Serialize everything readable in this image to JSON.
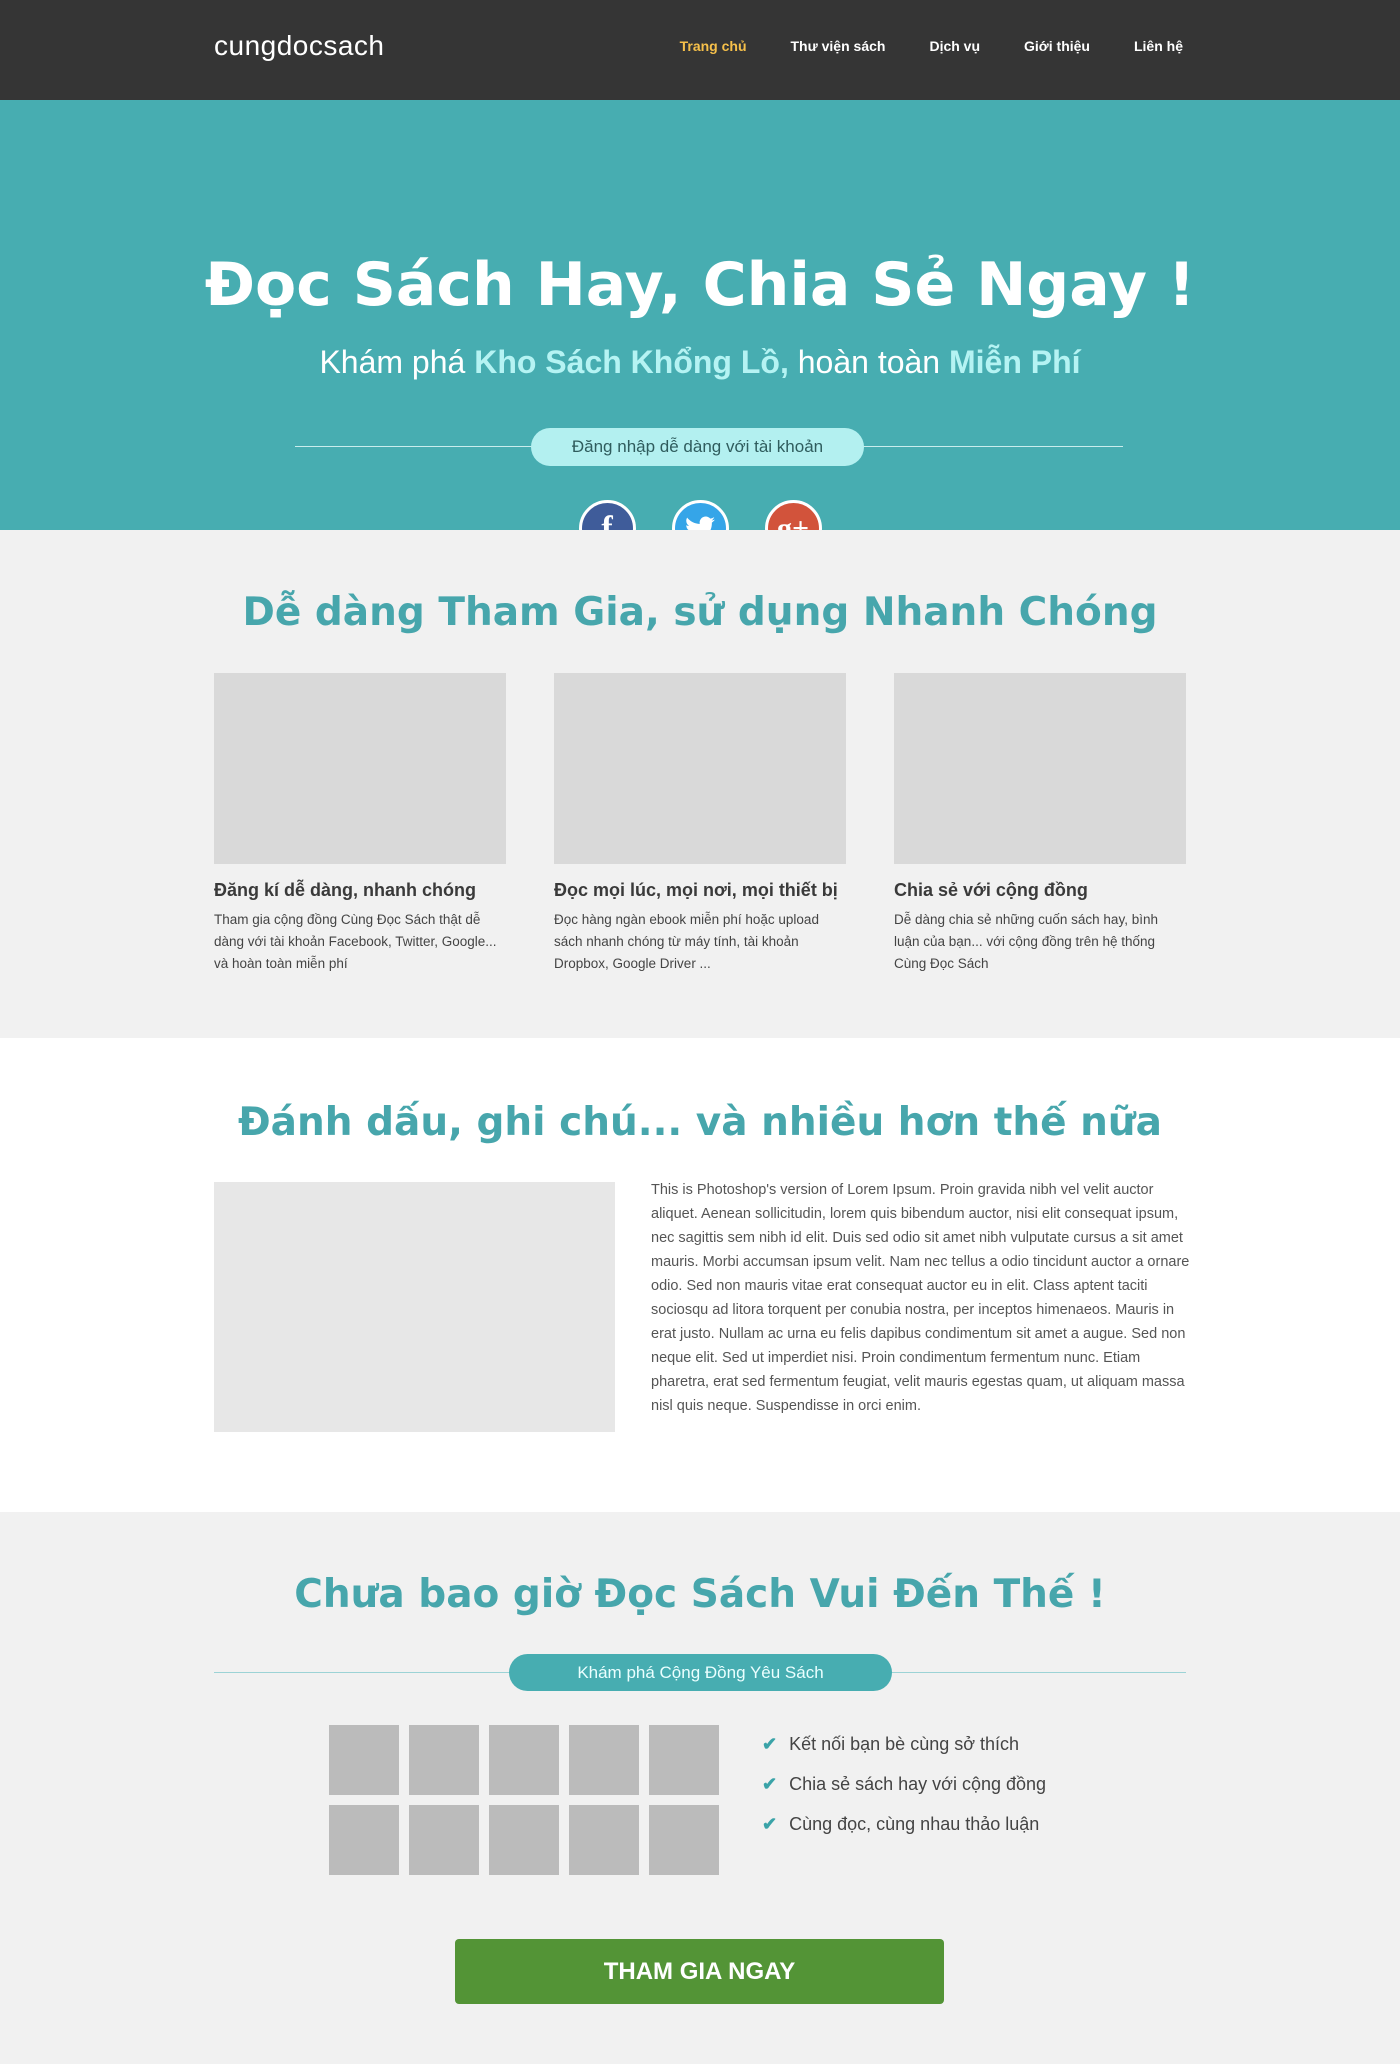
{
  "nav": {
    "logo": "cungdocsach",
    "items": [
      "Trang chủ",
      "Thư viện sách",
      "Dịch vụ",
      "Giới thiệu",
      "Liên hệ"
    ],
    "active_index": 0,
    "active_color": "#f6c04a"
  },
  "hero": {
    "title": "Đọc Sách Hay, Chia Sẻ Ngay !",
    "sub_prefix": "Khám phá ",
    "sub_bold1": "Kho Sách Khổng Lồ,",
    "sub_mid": " hoàn toàn ",
    "sub_bold2": "Miễn Phí",
    "login_pill": "Đăng nhập dễ dàng với tài khoản",
    "social": [
      "facebook-icon",
      "twitter-icon",
      "google-plus-icon"
    ],
    "background": "#47adb1"
  },
  "features": {
    "title": "Dễ dàng Tham Gia, sử dụng Nhanh Chóng",
    "items": [
      {
        "heading": "Đăng kí dễ dàng, nhanh chóng",
        "text": "Tham gia cộng đồng Cùng Đọc Sách thật dễ dàng với tài khoản Facebook, Twitter, Google... và hoàn toàn miễn phí"
      },
      {
        "heading": "Đọc mọi lúc, mọi nơi, mọi thiết bị",
        "text": "Đọc hàng ngàn ebook miễn phí hoặc upload sách nhanh chóng  từ máy tính, tài khoản Dropbox, Google Driver ..."
      },
      {
        "heading": "Chia sẻ với cộng đồng",
        "text": "Dễ dàng chia sẻ những cuốn sách hay, bình luận của bạn... với cộng đồng trên hệ thống Cùng Đọc Sách"
      }
    ]
  },
  "notes": {
    "title": "Đánh dấu, ghi chú... và nhiều hơn thế nữa",
    "text": "This is Photoshop's version  of Lorem Ipsum. Proin gravida nibh vel velit auctor aliquet. Aenean sollicitudin, lorem quis bibendum auctor, nisi elit consequat ipsum, nec sagittis sem nibh id elit. Duis sed odio sit amet nibh vulputate cursus a sit amet mauris. Morbi accumsan ipsum velit. Nam nec tellus a odio tincidunt auctor a ornare odio. Sed non  mauris vitae erat consequat auctor eu in elit. Class aptent taciti sociosqu ad litora torquent per conubia nostra, per inceptos himenaeos. Mauris in erat justo. Nullam ac urna eu felis dapibus condimentum sit amet a augue. Sed non neque elit. Sed ut imperdiet nisi. Proin condimentum fermentum nunc. Etiam pharetra, erat sed fermentum feugiat, velit mauris egestas quam, ut aliquam massa nisl quis neque. Suspendisse in orci enim."
  },
  "community": {
    "title": "Chưa bao giờ Đọc Sách Vui Đến Thế !",
    "pill": "Khám phá Cộng Đồng Yêu Sách",
    "checks": [
      "Kết nối bạn bè cùng sở thích",
      "Chia sẻ sách hay với cộng đồng",
      "Cùng đọc, cùng nhau thảo luận"
    ],
    "cta": "THAM GIA NGAY",
    "cta_color": "#539436"
  }
}
